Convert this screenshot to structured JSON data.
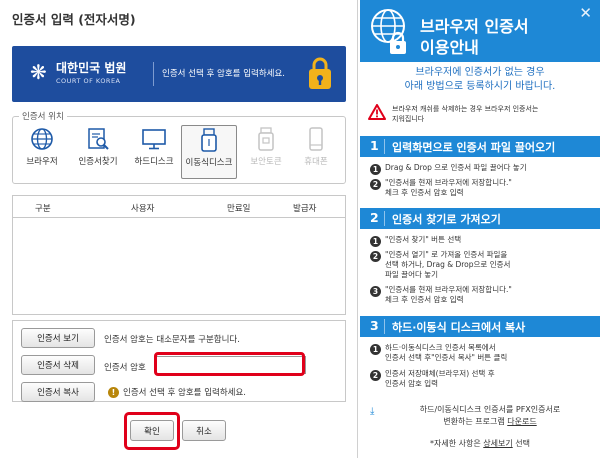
{
  "dialog": {
    "title": "인증서 입력 (전자서명)",
    "banner": {
      "court_name": "대한민국 법원",
      "court_en": "COURT OF KOREA",
      "message": "인증서 선택 후 암호를 입력하세요."
    },
    "location": {
      "legend": "인증서 위치",
      "items": [
        {
          "label": "브라우저",
          "icon": "globe-icon",
          "state": "normal"
        },
        {
          "label": "인증서찾기",
          "icon": "find-cert-icon",
          "state": "normal"
        },
        {
          "label": "하드디스크",
          "icon": "monitor-icon",
          "state": "normal"
        },
        {
          "label": "이동식디스크",
          "icon": "usb-icon",
          "state": "selected"
        },
        {
          "label": "보안토큰",
          "icon": "token-icon",
          "state": "disabled"
        },
        {
          "label": "휴대폰",
          "icon": "phone-icon",
          "state": "disabled"
        }
      ]
    },
    "table": {
      "columns": [
        "구분",
        "사용자",
        "만료일",
        "발급자"
      ],
      "rows": []
    },
    "buttons": {
      "view": "인증서 보기",
      "delete": "인증서 삭제",
      "copy": "인증서 복사",
      "confirm": "확인",
      "cancel": "취소"
    },
    "case_note": "인증서 암호는 대소문자를 구분합니다.",
    "password_label": "인증서 암호",
    "password_value": "",
    "hint": "인증서 선택 후 암호를 입력하세요.",
    "colors": {
      "banner": "#1e4d9e",
      "highlight": "#e0001a"
    }
  },
  "guide": {
    "title_line1": "브라우저 인증서",
    "title_line2": "이용안내",
    "intro_line1": "브라우저에 인증서가 없는 경우",
    "intro_line2": "아래 방법으로 등록하시기 바랍니다.",
    "warning_line1": "브라우저 캐쉬를 삭제하는 경우 브라우저 인증서는",
    "warning_line2": "지워집니다",
    "sections": [
      {
        "num": "1",
        "title": "입력화면으로 인증서 파일 끌어오기",
        "steps": [
          {
            "no": "1",
            "line1": "Drag & Drop 으로 인증서 파일 끌어다 놓기",
            "line2": ""
          },
          {
            "no": "2",
            "line1": "\"인증서를 현재 브라우저에 저장합니다.\"",
            "line2": "체크 후 인증서 암호 입력"
          }
        ]
      },
      {
        "num": "2",
        "title": "인증서 찾기로 가져오기",
        "steps": [
          {
            "no": "1",
            "line1": "\"인증서 찾기\" 버튼 선택",
            "line2": "",
            "line3": ""
          },
          {
            "no": "2",
            "line1": "\"인증서 열기\" 로 가져올 인증서 파일을",
            "line2": "선택 하거나, Drag & Drop으로 인증서",
            "line3": "파일 끌어다 놓기"
          },
          {
            "no": "3",
            "line1": "\"인증서를 현재 브라우저에 저장합니다.\"",
            "line2": "체크 후 인증서 암호 입력",
            "line3": ""
          }
        ]
      },
      {
        "num": "3",
        "title": "하드·이동식 디스크에서 복사",
        "steps": [
          {
            "no": "1",
            "line1": "하드·이동식디스크 인증서 목록에서",
            "line2": "인증서 선택 후\"인증서 복사\" 버튼 클릭"
          },
          {
            "no": "2",
            "line1": "인증서 저장매체(브라우저) 선택 후",
            "line2": "인증서 암호 입력"
          }
        ]
      }
    ],
    "download_line1": "하드/이동식디스크 인증서를 PFX인증서로",
    "download_pre": "변환하는 프로그램 ",
    "download_link": "다운로드",
    "detail_pre": "*자세한 사항은 ",
    "detail_link": "상세보기",
    "detail_post": " 선택",
    "colors": {
      "header": "#1e88d6",
      "text_blue": "#1e6fc0"
    }
  }
}
